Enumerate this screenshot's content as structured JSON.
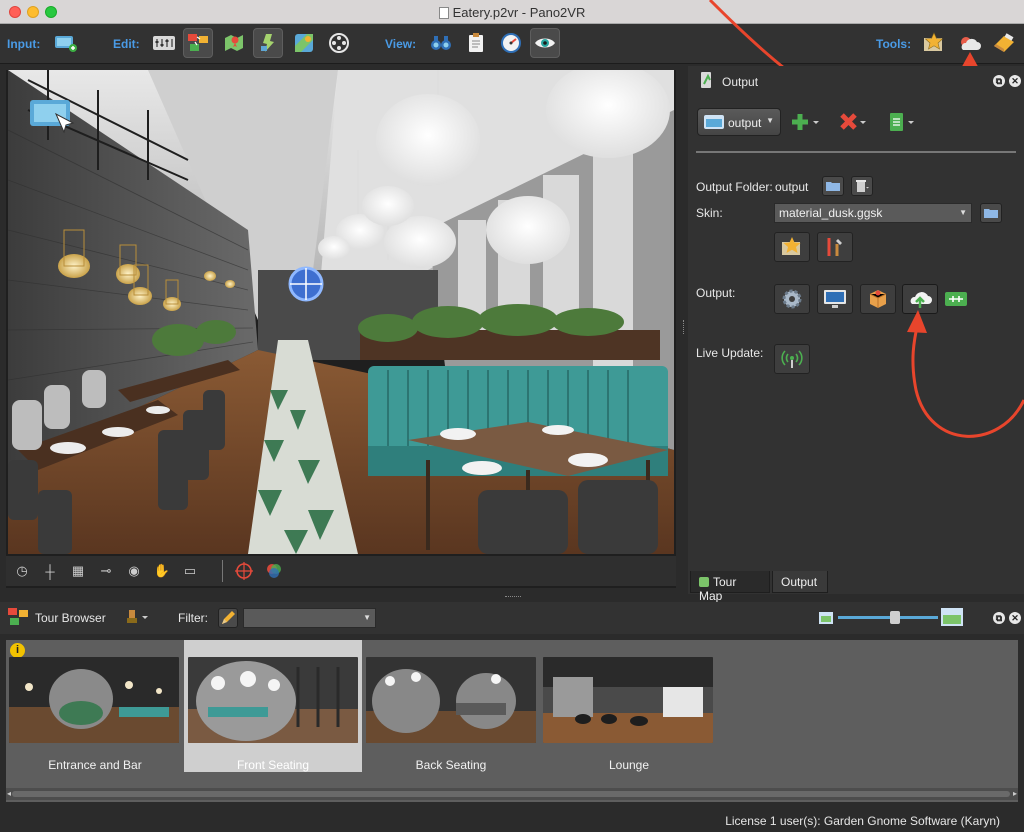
{
  "window": {
    "title": "Eatery.p2vr - Pano2VR"
  },
  "toolbar": {
    "input_label": "Input:",
    "edit_label": "Edit:",
    "view_label": "View:",
    "tools_label": "Tools:"
  },
  "viewer_tools": {
    "icons": [
      "compass-icon",
      "crosshair-icon",
      "grid-icon",
      "ruler-icon",
      "eye-icon",
      "hand-icon",
      "panorama-icon",
      "target-icon",
      "color-icon"
    ]
  },
  "output_panel": {
    "title": "Output",
    "output_select": "output",
    "output_folder_label": "Output Folder:",
    "output_folder_value": "output",
    "skin_label": "Skin:",
    "skin_value": "material_dusk.ggsk",
    "output_label": "Output:",
    "live_update_label": "Live Update:",
    "tabs": [
      "Tour Map",
      "Output"
    ],
    "active_tab": "Output"
  },
  "tour_browser": {
    "title": "Tour Browser",
    "filter_label": "Filter:",
    "filter_value": "",
    "thumbnails": [
      {
        "label": "Entrance and Bar",
        "selected": false
      },
      {
        "label": "Front Seating",
        "selected": true
      },
      {
        "label": "Back Seating",
        "selected": false
      },
      {
        "label": "Lounge",
        "selected": false
      }
    ],
    "info_badge": "i"
  },
  "status_bar": {
    "license": "License 1 user(s): Garden Gnome Software (Karyn)"
  },
  "colors": {
    "accent_label": "#4a9be6",
    "annotation_arrow": "#e8452c",
    "teal_booth": "#3e9a96",
    "upload_green": "#4caf50"
  }
}
